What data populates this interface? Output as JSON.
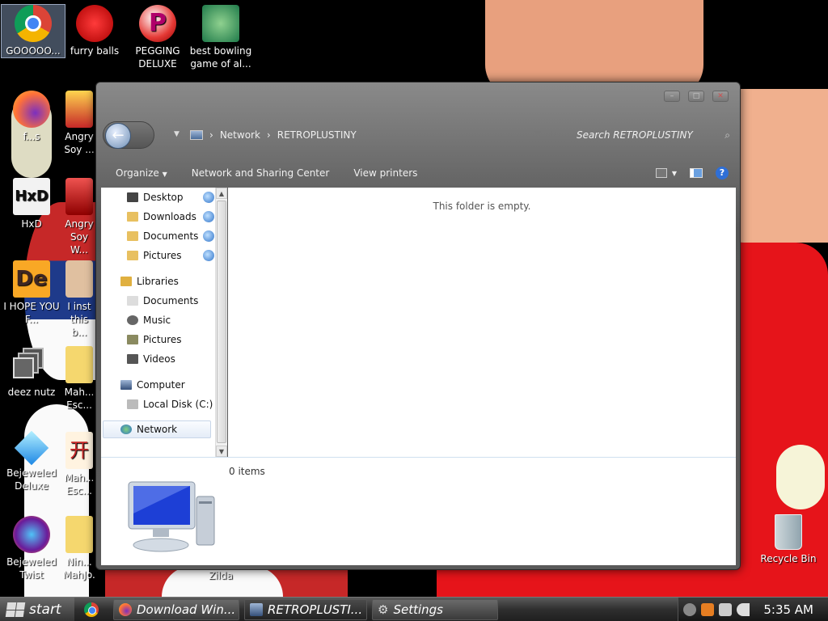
{
  "desktop": {
    "icons": [
      {
        "label": "GOOOOO...",
        "icon": "chrome-icon"
      },
      {
        "label": "furry balls",
        "icon": "red-fuzzball-icon"
      },
      {
        "label": "PEGGING DELUXE",
        "icon": "peggle-icon"
      },
      {
        "label": "best bowling game of al...",
        "icon": "bowling-santa-icon"
      },
      {
        "label": "f...s",
        "icon": "firefox-icon"
      },
      {
        "label": "Angry Soy ...",
        "icon": "angry-game-icon"
      },
      {
        "label": "HxD",
        "icon": "hxd-icon"
      },
      {
        "label": "Angry Soy W...",
        "icon": "angry-game-icon"
      },
      {
        "label": "I HOPE YOU F...",
        "icon": "de-icon"
      },
      {
        "label": "I inst this b...",
        "icon": "installer-icon"
      },
      {
        "label": "deez nutz",
        "icon": "shortcut-stack-icon"
      },
      {
        "label": "Mah... Esc...",
        "icon": "mahjong-icon"
      },
      {
        "label": "Bejeweled Deluxe",
        "icon": "gem-icon"
      },
      {
        "label": "Mah... Esc...",
        "icon": "mahjong-icon"
      },
      {
        "label": "Bejeweled Twist",
        "icon": "gem-twist-icon"
      },
      {
        "label": "Nin... MahJo...",
        "icon": "mahjong-icon"
      },
      {
        "label": "Zilda",
        "icon": "zilda-icon"
      },
      {
        "label": "Recycle Bin",
        "icon": "recycle-bin-icon"
      }
    ]
  },
  "window": {
    "address": {
      "segments": [
        "Network",
        "RETROPLUSTINY"
      ],
      "separator": "›"
    },
    "search": {
      "placeholder": "Search RETROPLUSTINY"
    },
    "toolbar": {
      "items": [
        "Organize",
        "Network and Sharing Center",
        "View printers"
      ]
    },
    "nav": {
      "favorites": [
        "Desktop",
        "Downloads",
        "Documents",
        "Pictures"
      ],
      "libraries_header": "Libraries",
      "libraries": [
        "Documents",
        "Music",
        "Pictures",
        "Videos"
      ],
      "computer_header": "Computer",
      "computer": [
        "Local Disk (C:)"
      ],
      "network_header": "Network"
    },
    "content": {
      "empty_message": "This folder is empty."
    },
    "details": {
      "item_count": "0 items"
    }
  },
  "taskbar": {
    "start_label": "start",
    "tasks": [
      "Download Win...",
      "RETROPLUSTI...",
      "Settings"
    ],
    "clock": "5:35 AM"
  }
}
